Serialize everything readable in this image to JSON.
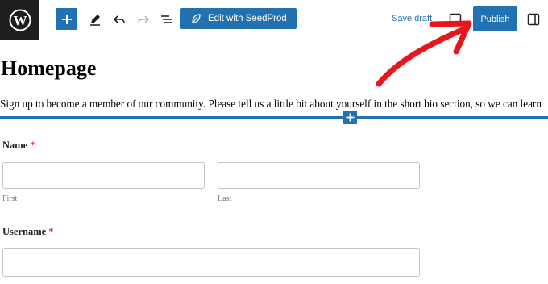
{
  "toolbar": {
    "seedprod_label": "Edit with SeedProd",
    "save_draft_label": "Save draft",
    "publish_label": "Publish"
  },
  "page": {
    "title": "Homepage",
    "intro_text": "Sign up to become a member of our community. Please tell us a little bit about yourself in the short bio section, so we can learn"
  },
  "form": {
    "name_label": "Name",
    "required_mark": "*",
    "first_sublabel": "First",
    "last_sublabel": "Last",
    "username_label": "Username"
  },
  "icons": [
    "wordpress-logo-icon",
    "plus-icon",
    "pencil-icon",
    "undo-icon",
    "redo-icon",
    "list-view-icon",
    "seedprod-leaf-icon",
    "preview-icon",
    "settings-sidebar-icon"
  ],
  "colors": {
    "accent": "#2271b1",
    "annotation_arrow": "#e8151c",
    "required": "#cc0000"
  }
}
